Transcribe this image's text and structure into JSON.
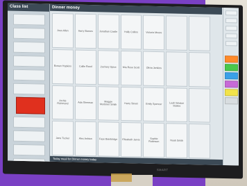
{
  "sidebar": {
    "title": "Class list",
    "classes": [
      {
        "label": ""
      },
      {
        "label": ""
      },
      {
        "label": ""
      },
      {
        "label": ""
      },
      {
        "label": ""
      },
      {
        "label": ""
      },
      {
        "label": "",
        "selected": true
      },
      {
        "label": ""
      },
      {
        "label": ""
      },
      {
        "label": ""
      },
      {
        "label": ""
      },
      {
        "label": ""
      }
    ]
  },
  "main": {
    "title": "Dinner money",
    "footer": "Today meal for Dinner money today",
    "grid": [
      [
        "Joes Allen",
        "Harry Barnes",
        "Jonathan Castle",
        "Holly Collins",
        "Victoria Moore",
        "",
        ""
      ],
      [
        "Bowen Hopkins",
        "Callie Reed",
        "Zachary Spice",
        "Mia Rose Scott",
        "Olivia Jenkins",
        "",
        ""
      ],
      [
        "Archie Richmond",
        "Ada Sherman",
        "Maggie Mortimer Smith",
        "Harry Street",
        "Emily Spencer",
        "Leah Weston Stokes",
        ""
      ],
      [
        "Jane Tucker",
        "Alex Ashton",
        "Faye Bainbridge",
        "Elizabeth Jarvis",
        "Sophie Robinson",
        "Noah Smith",
        ""
      ]
    ]
  },
  "right_panel": {
    "items": [
      {
        "label": ""
      },
      {
        "label": ""
      },
      {
        "label": ""
      },
      {
        "label": ""
      },
      {
        "label": ""
      }
    ],
    "swatches": [
      "#ff8a2a",
      "#49c84a",
      "#3aa0e8",
      "#c76ad6",
      "#f2e34a",
      "#d8dde0"
    ]
  },
  "device": {
    "brand": "SMART"
  }
}
